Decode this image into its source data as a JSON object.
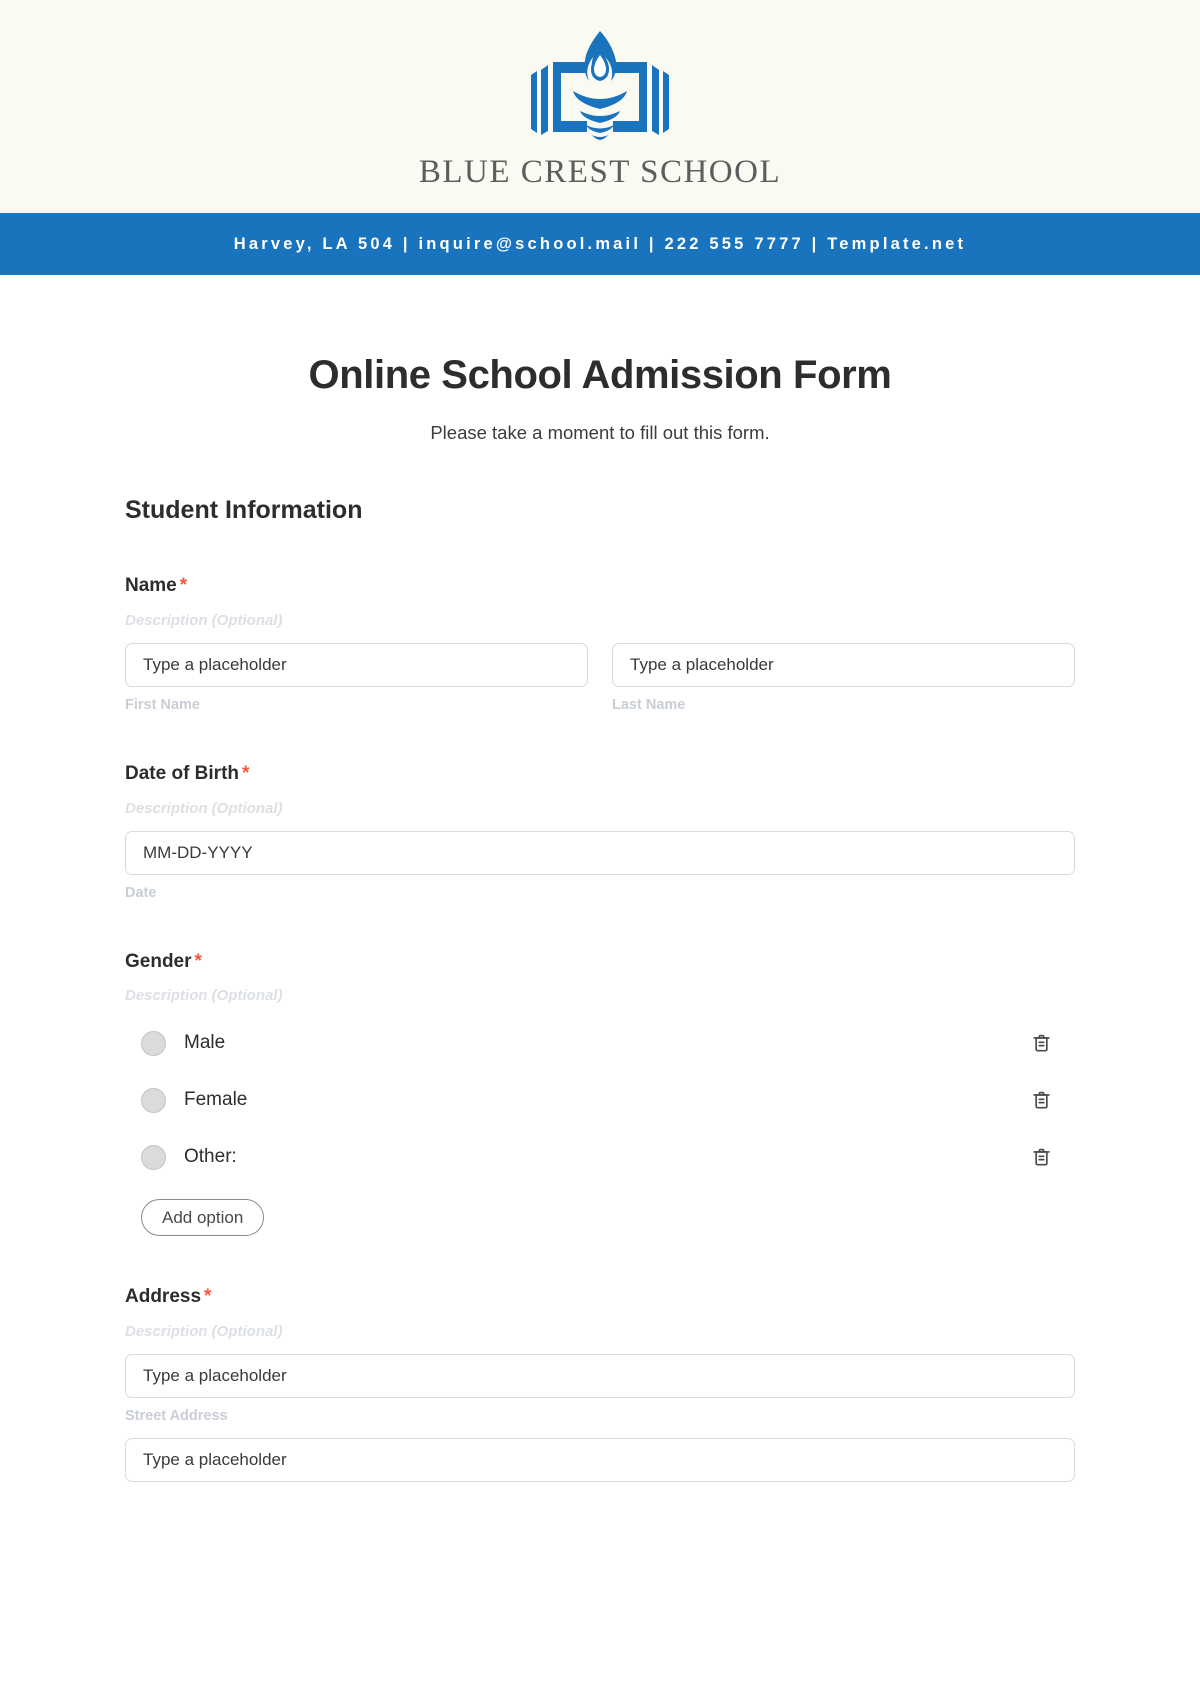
{
  "letterhead": {
    "logo_icon": "book-torch-logo-icon",
    "school_name": "BLUE CREST SCHOOL",
    "brand_blue": "#1a73bd",
    "paper_bg": "#fafaf2"
  },
  "contact_bar": {
    "text": "Harvey, LA 504 | inquire@school.mail | 222 555 7777 | Template.net",
    "bg": "#1a73bd"
  },
  "form": {
    "title": "Online School Admission Form",
    "subtitle": "Please take a moment to fill out this form.",
    "section_heading": "Student Information",
    "required_marker": "*",
    "required_color": "#f4573b",
    "description_placeholder": "Description (Optional)"
  },
  "fields": {
    "name": {
      "label": "Name",
      "description": "Description (Optional)",
      "first": {
        "placeholder": "Type a placeholder",
        "value": "Type a placeholder",
        "sub_label": "First Name"
      },
      "last": {
        "placeholder": "Type a placeholder",
        "value": "Type a placeholder",
        "sub_label": "Last Name"
      }
    },
    "dob": {
      "label": "Date of Birth",
      "description": "Description (Optional)",
      "placeholder": "MM-DD-YYYY",
      "value": "MM-DD-YYYY",
      "sub_label": "Date"
    },
    "gender": {
      "label": "Gender",
      "description": "Description (Optional)",
      "options": [
        {
          "label": "Male",
          "delete_icon": "trash-icon"
        },
        {
          "label": "Female",
          "delete_icon": "trash-icon"
        },
        {
          "label": "Other:",
          "delete_icon": "trash-icon"
        }
      ],
      "add_option_label": "Add option"
    },
    "address": {
      "label": "Address",
      "description": "Description (Optional)",
      "street": {
        "placeholder": "Type a placeholder",
        "value": "Type a placeholder",
        "sub_label": "Street Address"
      },
      "line2": {
        "placeholder": "Type a placeholder",
        "value": "Type a placeholder"
      }
    }
  }
}
